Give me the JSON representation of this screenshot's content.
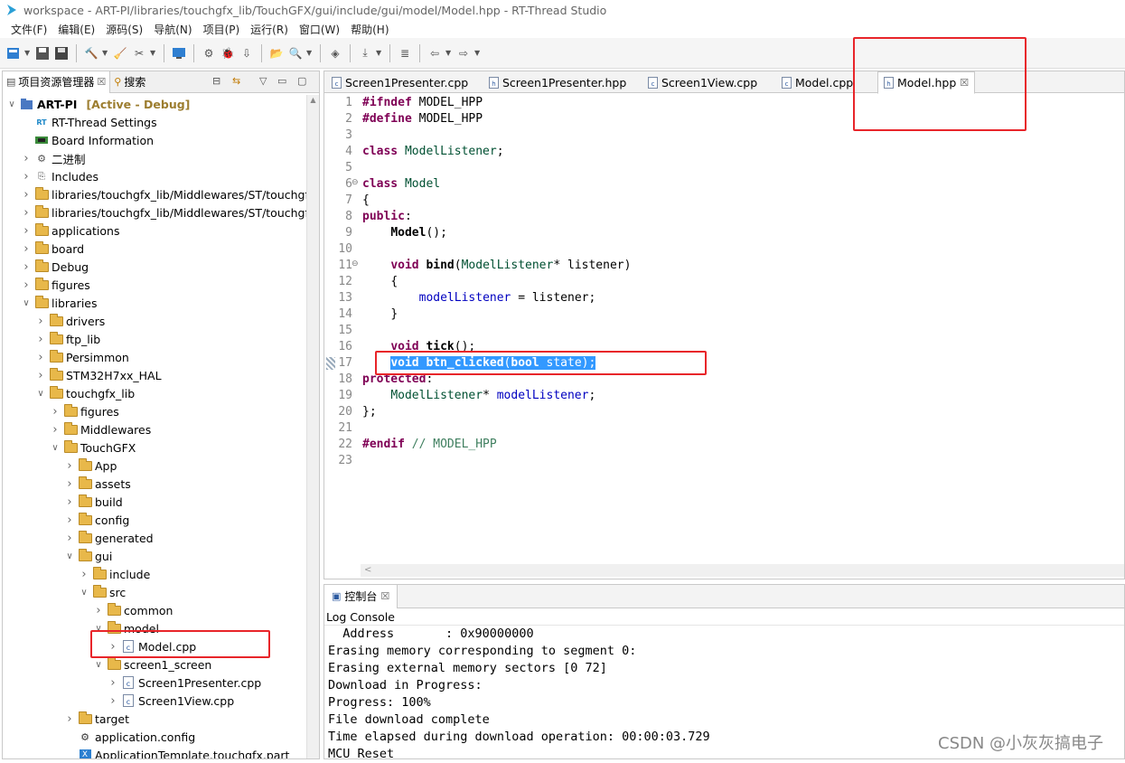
{
  "window": {
    "title": "workspace - ART-PI/libraries/touchgfx_lib/TouchGFX/gui/include/gui/model/Model.hpp - RT-Thread Studio"
  },
  "menu": [
    "文件(F)",
    "编辑(E)",
    "源码(S)",
    "导航(N)",
    "项目(P)",
    "运行(R)",
    "窗口(W)",
    "帮助(H)"
  ],
  "left_panel": {
    "tabs": [
      {
        "label": "项目资源管理器",
        "close": "☒"
      },
      {
        "label": "搜索"
      }
    ],
    "tree": [
      {
        "label": "ART-PI",
        "suffix": "[Active - Debug]",
        "icon": "project",
        "level": 0,
        "expanded": true
      },
      {
        "label": "RT-Thread Settings",
        "icon": "rt-settings",
        "level": 1,
        "leaf": true
      },
      {
        "label": "Board Information",
        "icon": "board-info",
        "level": 1,
        "leaf": true
      },
      {
        "label": "二进制",
        "icon": "binaries",
        "level": 1
      },
      {
        "label": "Includes",
        "icon": "includes",
        "level": 1
      },
      {
        "label": "libraries/touchgfx_lib/Middlewares/ST/touchgfx",
        "icon": "linked-folder",
        "level": 1
      },
      {
        "label": "libraries/touchgfx_lib/Middlewares/ST/touchgfx",
        "icon": "linked-folder",
        "level": 1
      },
      {
        "label": "applications",
        "icon": "folder",
        "level": 1
      },
      {
        "label": "board",
        "icon": "folder",
        "level": 1
      },
      {
        "label": "Debug",
        "icon": "folder",
        "level": 1
      },
      {
        "label": "figures",
        "icon": "folder",
        "level": 1
      },
      {
        "label": "libraries",
        "icon": "folder",
        "level": 1,
        "expanded": true
      },
      {
        "label": "drivers",
        "icon": "folder",
        "level": 2
      },
      {
        "label": "ftp_lib",
        "icon": "folder",
        "level": 2
      },
      {
        "label": "Persimmon",
        "icon": "folder",
        "level": 2
      },
      {
        "label": "STM32H7xx_HAL",
        "icon": "folder",
        "level": 2
      },
      {
        "label": "touchgfx_lib",
        "icon": "folder",
        "level": 2,
        "expanded": true
      },
      {
        "label": "figures",
        "icon": "folder",
        "level": 3
      },
      {
        "label": "Middlewares",
        "icon": "folder",
        "level": 3
      },
      {
        "label": "TouchGFX",
        "icon": "folder",
        "level": 3,
        "expanded": true
      },
      {
        "label": "App",
        "icon": "folder",
        "level": 4
      },
      {
        "label": "assets",
        "icon": "folder",
        "level": 4
      },
      {
        "label": "build",
        "icon": "folder",
        "level": 4
      },
      {
        "label": "config",
        "icon": "folder",
        "level": 4
      },
      {
        "label": "generated",
        "icon": "folder",
        "level": 4
      },
      {
        "label": "gui",
        "icon": "folder",
        "level": 4,
        "expanded": true
      },
      {
        "label": "include",
        "icon": "folder",
        "level": 5
      },
      {
        "label": "src",
        "icon": "folder",
        "level": 5,
        "expanded": true
      },
      {
        "label": "common",
        "icon": "folder",
        "level": 6
      },
      {
        "label": "model",
        "icon": "folder",
        "level": 6,
        "expanded": true
      },
      {
        "label": "Model.cpp",
        "icon": "cpp-file",
        "level": 7
      },
      {
        "label": "screen1_screen",
        "icon": "folder",
        "level": 6,
        "expanded": true
      },
      {
        "label": "Screen1Presenter.cpp",
        "icon": "cpp-file",
        "level": 7
      },
      {
        "label": "Screen1View.cpp",
        "icon": "cpp-file",
        "level": 7
      },
      {
        "label": "target",
        "icon": "folder",
        "level": 4
      },
      {
        "label": "application.config",
        "icon": "config-file",
        "level": 4,
        "leaf": true
      },
      {
        "label": "ApplicationTemplate.touchgfx.part",
        "icon": "touchgfx-file",
        "level": 4,
        "leaf": true
      }
    ]
  },
  "editor": {
    "tabs": [
      {
        "label": "Screen1Presenter.cpp",
        "type": "c"
      },
      {
        "label": "Screen1Presenter.hpp",
        "type": "h"
      },
      {
        "label": "Screen1View.cpp",
        "type": "c"
      },
      {
        "label": "Model.cpp",
        "type": "c"
      },
      {
        "label": "Model.hpp",
        "type": "h",
        "active": true,
        "close": "☒"
      }
    ],
    "lines": [
      "1",
      "2",
      "3",
      "4",
      "5",
      "6",
      "7",
      "8",
      "9",
      "10",
      "11",
      "12",
      "13",
      "14",
      "15",
      "16",
      "17",
      "18",
      "19",
      "20",
      "21",
      "22",
      "23"
    ],
    "code": {
      "l1_kw": "#ifndef",
      "l1_rest": " MODEL_HPP",
      "l2_kw": "#define",
      "l2_rest": " MODEL_HPP",
      "l4_kw": "class",
      "l4_ty": "ModelListener",
      "l4_end": ";",
      "l6_kw": "class",
      "l6_ty": "Model",
      "l7": "{",
      "l8_kw": "public",
      "l8_end": ":",
      "l9_fn": "Model",
      "l9_end": "();",
      "l11_kw": "void",
      "l11_fn": "bind",
      "l11_p1": "(",
      "l11_ty": "ModelListener",
      "l11_rest": "* listener)",
      "l12": "{",
      "l13_fld": "modelListener",
      "l13_rest": " = listener;",
      "l14": "}",
      "l16_kw": "void",
      "l16_fn": "tick",
      "l16_end": "();",
      "l17_kw": "void",
      "l17_fn": "btn_clicked",
      "l17_p1": "(",
      "l17_kw2": "bool",
      "l17_rest": " state);",
      "l18_kw": "protected",
      "l18_end": ":",
      "l19_ty": "ModelListener",
      "l19_mid": "* ",
      "l19_fld": "modelListener",
      "l19_end": ";",
      "l20": "};",
      "l22_kw": "#endif",
      "l22_cm": " // MODEL_HPP"
    },
    "fold_markers": [
      "⊖",
      "⊖"
    ]
  },
  "console": {
    "tab_label": "控制台",
    "tab_close": "☒",
    "header": "Log Console",
    "lines": [
      "  Address       : 0x90000000",
      "Erasing memory corresponding to segment 0:",
      "Erasing external memory sectors [0 72]",
      "Download in Progress:",
      "Progress: 100%",
      "File download complete",
      "Time elapsed during download operation: 00:00:03.729",
      "MCU Reset"
    ]
  },
  "watermark": "CSDN @小灰灰搞电子",
  "colors": {
    "keyword": "#7f0055",
    "type": "#005032",
    "field": "#0000c0",
    "comment": "#3f7f5f",
    "selection": "#3399ff",
    "annotation_box": "#e8252a",
    "folder": "#e8b84a"
  }
}
